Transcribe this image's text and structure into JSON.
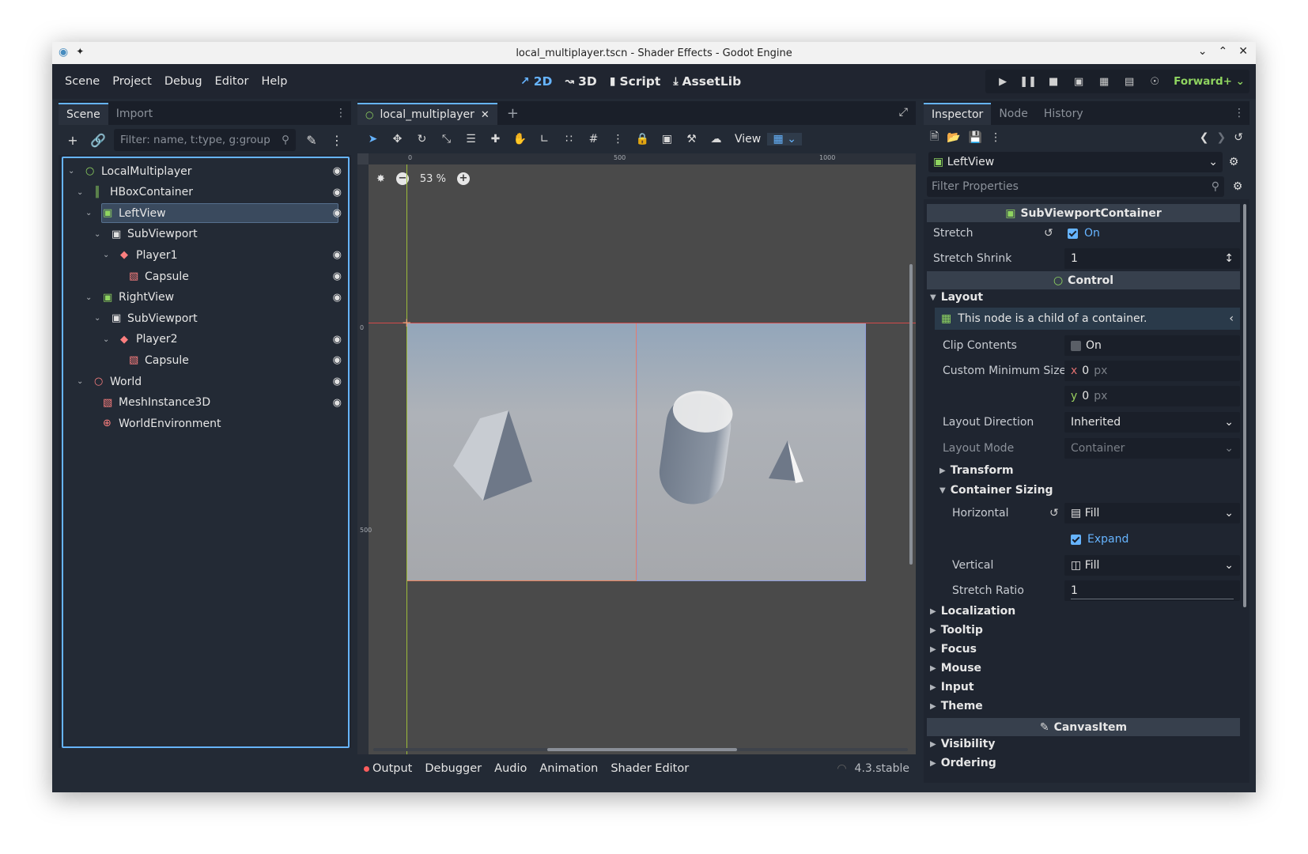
{
  "window": {
    "title": "local_multiplayer.tscn - Shader Effects - Godot Engine"
  },
  "menubar": {
    "menus": [
      "Scene",
      "Project",
      "Debug",
      "Editor",
      "Help"
    ],
    "workspaces": [
      {
        "label": "2D",
        "icon": "2d-icon",
        "active": true
      },
      {
        "label": "3D",
        "icon": "3d-icon",
        "active": false
      },
      {
        "label": "Script",
        "icon": "script-icon",
        "active": false
      },
      {
        "label": "AssetLib",
        "icon": "assetlib-icon",
        "active": false
      }
    ],
    "renderer": "Forward+"
  },
  "scene_dock": {
    "tabs": [
      "Scene",
      "Import"
    ],
    "filter_placeholder": "Filter: name, t:type, g:group",
    "tree": [
      {
        "name": "LocalMultiplayer",
        "icon": "control-icon",
        "color": "#8fd460",
        "depth": 0,
        "expanded": true,
        "visible_toggle": true
      },
      {
        "name": "HBoxContainer",
        "icon": "hbox-icon",
        "color": "#8fd460",
        "depth": 1,
        "expanded": true,
        "visible_toggle": true
      },
      {
        "name": "LeftView",
        "icon": "subviewport-container-icon",
        "color": "#8fd460",
        "depth": 2,
        "expanded": true,
        "visible_toggle": true,
        "selected": true
      },
      {
        "name": "SubViewport",
        "icon": "subviewport-icon",
        "color": "#e0e0e0",
        "depth": 3,
        "expanded": true,
        "visible_toggle": false
      },
      {
        "name": "Player1",
        "icon": "character-icon",
        "color": "#fc7f7f",
        "depth": 4,
        "expanded": true,
        "visible_toggle": true
      },
      {
        "name": "Capsule",
        "icon": "mesh-icon",
        "color": "#fc7f7f",
        "depth": 5,
        "expanded": false,
        "visible_toggle": true
      },
      {
        "name": "RightView",
        "icon": "subviewport-container-icon",
        "color": "#8fd460",
        "depth": 2,
        "expanded": true,
        "visible_toggle": true
      },
      {
        "name": "SubViewport",
        "icon": "subviewport-icon",
        "color": "#e0e0e0",
        "depth": 3,
        "expanded": true,
        "visible_toggle": false
      },
      {
        "name": "Player2",
        "icon": "character-icon",
        "color": "#fc7f7f",
        "depth": 4,
        "expanded": true,
        "visible_toggle": true
      },
      {
        "name": "Capsule",
        "icon": "mesh-icon",
        "color": "#fc7f7f",
        "depth": 5,
        "expanded": false,
        "visible_toggle": true
      },
      {
        "name": "World",
        "icon": "node3d-icon",
        "color": "#fc7f7f",
        "depth": 1,
        "expanded": true,
        "visible_toggle": true
      },
      {
        "name": "MeshInstance3D",
        "icon": "mesh-icon",
        "color": "#fc7f7f",
        "depth": 2,
        "expanded": false,
        "visible_toggle": true
      },
      {
        "name": "WorldEnvironment",
        "icon": "world-environment-icon",
        "color": "#fc7f7f",
        "depth": 2,
        "expanded": false,
        "visible_toggle": false
      }
    ]
  },
  "viewport": {
    "tab": "local_multiplayer",
    "view_label": "View",
    "zoom": "53 %",
    "ruler_ticks": [
      "0",
      "500",
      "1000"
    ],
    "ruler_left_ticks": [
      "0",
      "500"
    ]
  },
  "bottom_panel": {
    "tabs": [
      "Output",
      "Debugger",
      "Audio",
      "Animation",
      "Shader Editor"
    ],
    "version": "4.3.stable"
  },
  "inspector": {
    "tabs": [
      "Inspector",
      "Node",
      "History"
    ],
    "object": "LeftView",
    "filter_placeholder": "Filter Properties",
    "class_header": "SubViewportContainer",
    "stretch_label": "Stretch",
    "stretch_value": "On",
    "stretch_shrink_label": "Stretch Shrink",
    "stretch_shrink_value": "1",
    "control_header": "Control",
    "layout_section": "Layout",
    "info_text": "This node is a child of a container.",
    "clip_contents_label": "Clip Contents",
    "clip_contents_value": "On",
    "custom_min_size_label": "Custom Minimum Size",
    "min_x_axis": "x",
    "min_x": "0",
    "min_y_axis": "y",
    "min_y": "0",
    "unit": "px",
    "layout_direction_label": "Layout Direction",
    "layout_direction_value": "Inherited",
    "layout_mode_label": "Layout Mode",
    "layout_mode_value": "Container",
    "transform_section": "Transform",
    "container_sizing_section": "Container Sizing",
    "horizontal_label": "Horizontal",
    "horizontal_value": "Fill",
    "expand_label": "Expand",
    "vertical_label": "Vertical",
    "vertical_value": "Fill",
    "stretch_ratio_label": "Stretch Ratio",
    "stretch_ratio_value": "1",
    "sections": [
      "Localization",
      "Tooltip",
      "Focus",
      "Mouse",
      "Input",
      "Theme"
    ],
    "canvasitem_header": "CanvasItem",
    "canvasitem_sections": [
      "Visibility",
      "Ordering"
    ]
  },
  "colors": {
    "accent": "#66b4ff",
    "control_green": "#8fd460",
    "node3d_red": "#fc7f7f"
  }
}
